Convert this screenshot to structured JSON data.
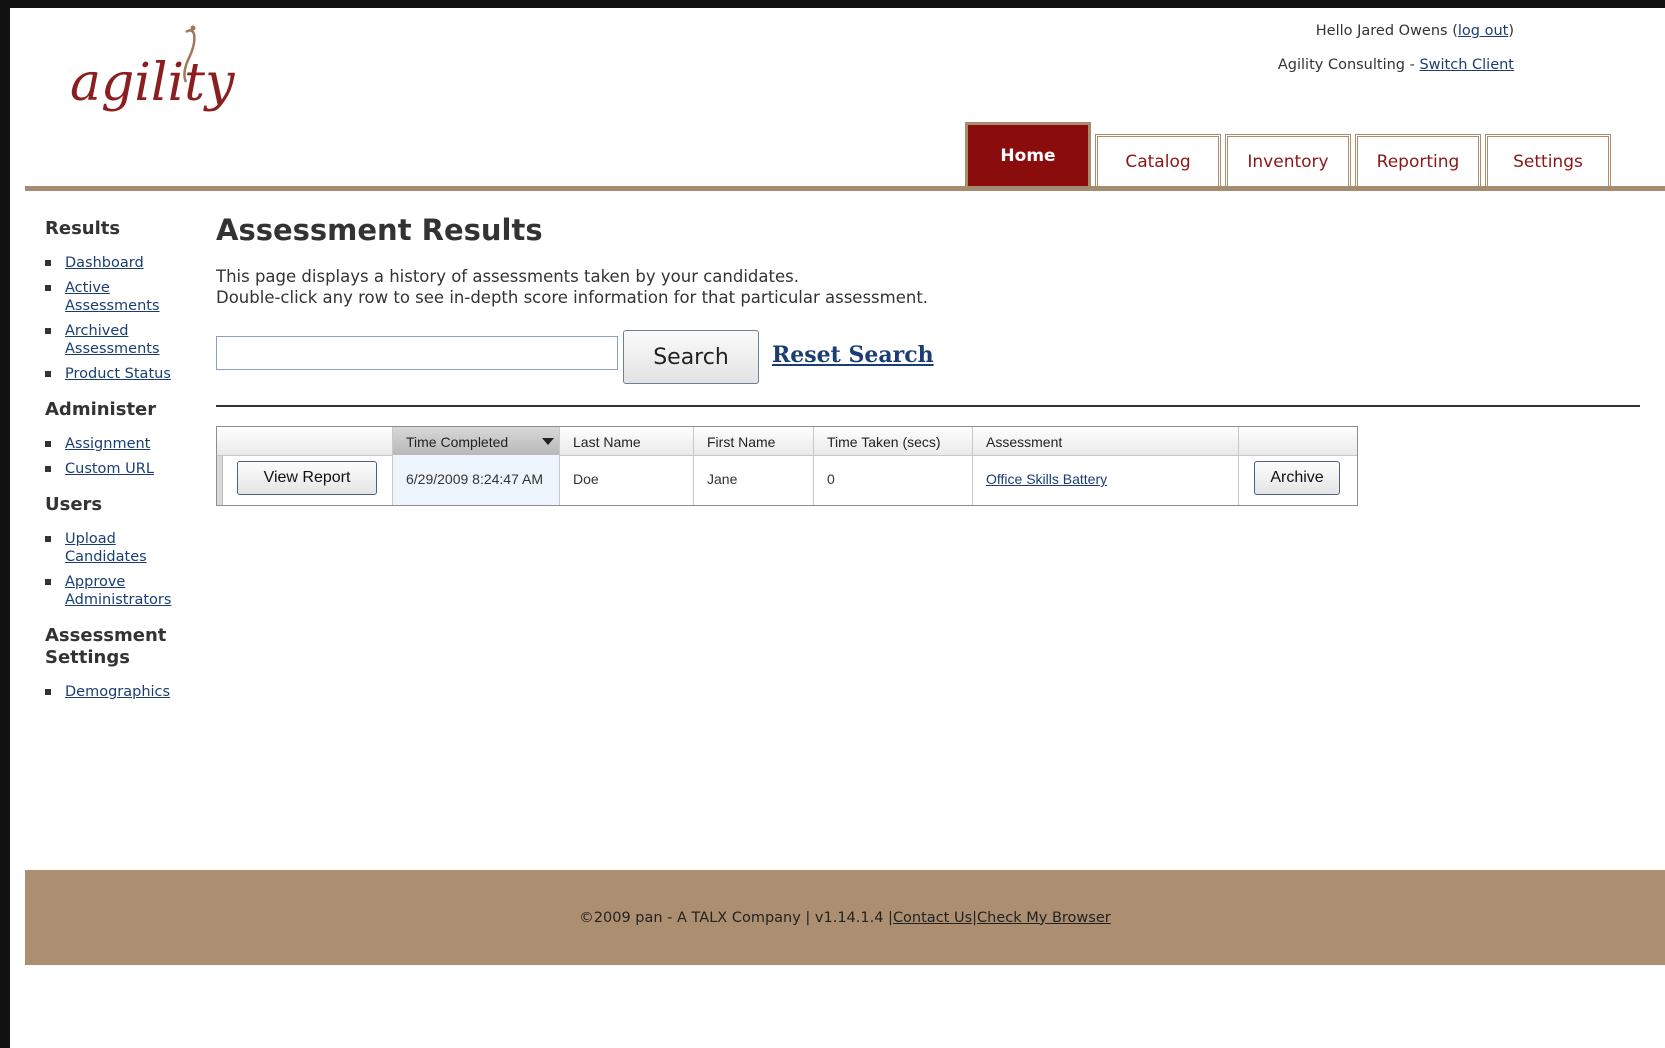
{
  "header": {
    "logo_text": "agility",
    "greeting": "Hello Jared Owens (",
    "logout_label": "log out",
    "greeting_close": ")",
    "client_name": "Agility Consulting - ",
    "switch_client_label": "Switch Client"
  },
  "tabs": [
    {
      "label": "Home",
      "active": true
    },
    {
      "label": "Catalog",
      "active": false
    },
    {
      "label": "Inventory",
      "active": false
    },
    {
      "label": "Reporting",
      "active": false
    },
    {
      "label": "Settings",
      "active": false
    }
  ],
  "sidebar": {
    "sections": [
      {
        "title": "Results",
        "items": [
          "Dashboard",
          "Active Assessments",
          "Archived Assessments",
          "Product Status"
        ]
      },
      {
        "title": "Administer",
        "items": [
          "Assignment",
          "Custom URL"
        ]
      },
      {
        "title": "Users",
        "items": [
          "Upload Candidates",
          "Approve Administrators"
        ]
      },
      {
        "title": "Assessment Settings",
        "items": [
          "Demographics"
        ]
      }
    ]
  },
  "main": {
    "title": "Assessment Results",
    "description_line1": "This page displays a history of assessments taken by your candidates.",
    "description_line2": "Double-click any row to see in-depth score information for that particular assessment.",
    "search": {
      "value": "",
      "placeholder": "",
      "button_label": "Search",
      "reset_label": "Reset Search"
    }
  },
  "grid": {
    "columns": [
      "",
      "Time Completed",
      "Last Name",
      "First Name",
      "Time Taken (secs)",
      "Assessment",
      ""
    ],
    "sorted_column": "Time Completed",
    "rows": [
      {
        "view_button": "View Report",
        "time_completed": "6/29/2009 8:24:47 AM",
        "last_name": "Doe",
        "first_name": "Jane",
        "time_taken": "0",
        "assessment": "Office Skills Battery",
        "archive_button": "Archive"
      }
    ]
  },
  "footer": {
    "copyright": "©2009 pan - A TALX Company | v1.14.1.4 | ",
    "contact_label": "Contact Us",
    "separator": " | ",
    "browser_label": "Check My Browser"
  },
  "colors": {
    "brand_maroon": "#8b0c0c",
    "brand_tan": "#ac8f70",
    "link_blue": "#1a3e74"
  }
}
